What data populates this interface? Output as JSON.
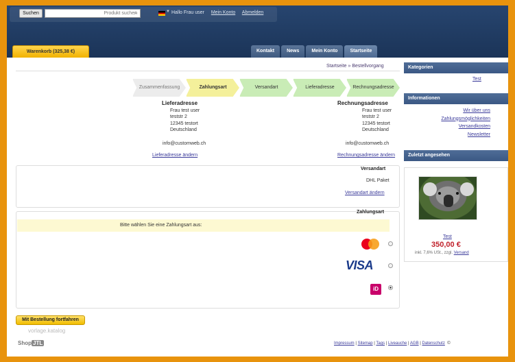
{
  "header": {
    "search_button": "Suchen",
    "search_placeholder": "Produkt suchen",
    "greeting": "Hallo Frau user",
    "my_account": "Mein Konto",
    "logout": "Abmelden",
    "cart": "Warenkorb (325,38 €)"
  },
  "nav": {
    "tabs": [
      {
        "label": "Startseite"
      },
      {
        "label": "Mein Konto"
      },
      {
        "label": "News"
      },
      {
        "label": "Kontakt"
      }
    ]
  },
  "breadcrumb": "Startseite » Bestellvorgang",
  "steps": [
    {
      "label": "Rechnungsadresse"
    },
    {
      "label": "Lieferadresse"
    },
    {
      "label": "Versandart"
    },
    {
      "label": "Zahlungsart"
    },
    {
      "label": "Zusammenfassung"
    }
  ],
  "billing": {
    "title": "Rechnungsadresse",
    "name": "Frau test user",
    "street": "teststr 2",
    "city": "12345 testort",
    "country": "Deutschland",
    "email": "info@customweb.ch",
    "change": "Rechnungsadresse ändern"
  },
  "shipping_addr": {
    "title": "Lieferadresse",
    "name": "Frau test user",
    "street": "teststr 2",
    "city": "12345 testort",
    "country": "Deutschland",
    "email": "info@customweb.ch",
    "change": "Lieferadresse ändern"
  },
  "shipping_method": {
    "title": "Versandart",
    "value": "DHL Paket",
    "change": "Versandart ändern"
  },
  "payment": {
    "title": "Zahlungsart",
    "prompt": "Bitte wählen Sie eine Zahlungsart aus:",
    "methods": [
      {
        "icon": "mastercard-icon"
      },
      {
        "icon": "visa-icon"
      },
      {
        "icon": "ideal-icon"
      }
    ]
  },
  "continue_button": "Mit Bestellung fortfahren",
  "watermark": "vorlage.katalog",
  "footer": {
    "copyright": "©",
    "links": [
      "Datenschutz",
      "AGB",
      "Liveauche",
      "Tags",
      "Sitemap",
      "Impressum"
    ]
  },
  "jtl": {
    "brand": "JTL",
    "suffix": "Shop"
  },
  "sidebar": {
    "categories_title": "Kategorien",
    "categories": [
      "Test"
    ],
    "info_title": "Informationen",
    "info_links": [
      "Wir über uns",
      "Zahlungsmöglichkeiten",
      "Versandkosten",
      "Newsletter"
    ],
    "recent_title": "Zuletzt angesehen",
    "product_name": "Test",
    "product_price": "350,00 €",
    "product_tax": "inkl. 7,6% USt., zzgl.",
    "product_shipping": "Versand"
  }
}
